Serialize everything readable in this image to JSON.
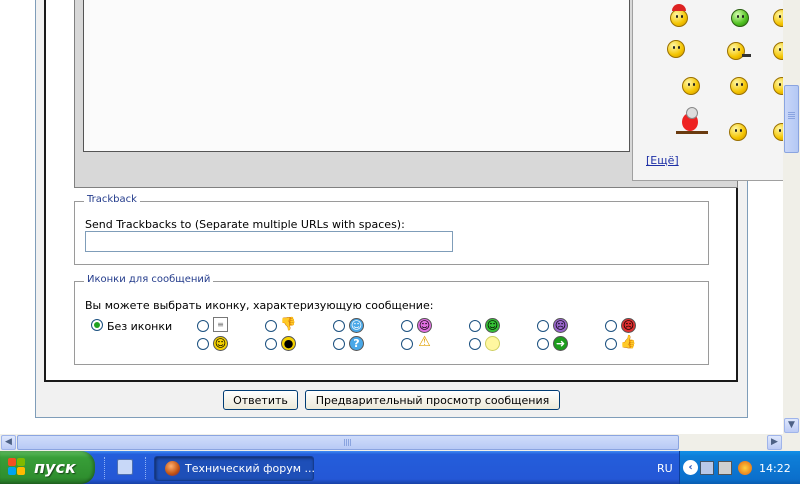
{
  "smilies": {
    "more_link": "[Ещё]",
    "icons": [
      "santa-smiley-icon",
      "green-smiley-icon",
      "smiley-icon",
      "waving-smiley-icon",
      "smoking-smiley-icon",
      "nurse-smiley-icon",
      "smiley-icon",
      "smiley-icon",
      "parrot-icon",
      "angry-smiley-icon",
      "smiley-icon"
    ]
  },
  "trackback": {
    "legend": "Trackback",
    "label": "Send Trackbacks to (Separate multiple URLs with spaces):",
    "value": ""
  },
  "post_icons": {
    "legend": "Иконки для сообщений",
    "label": "Вы можете выбрать иконку, характеризующую сообщение:",
    "no_icon_label": "Без иконки",
    "selected": "none",
    "icons": [
      "document-icon",
      "thumbs-down-icon",
      "wink-icon",
      "pink-smiley-icon",
      "grin-icon",
      "purple-frown-icon",
      "angry-icon",
      "smile-icon",
      "cool-icon",
      "question-icon",
      "warning-icon",
      "lightbulb-icon",
      "arrow-icon",
      "thumbs-up-icon"
    ]
  },
  "buttons": {
    "reply": "Ответить",
    "preview": "Предварительный просмотр сообщения"
  },
  "taskbar": {
    "start_label": "пуск",
    "task_label": "Технический форум ...",
    "language": "RU",
    "clock": "14:22"
  },
  "colors": {
    "taskbar_blue": "#245edb",
    "start_green": "#389e38",
    "link_blue": "#1d2fa6",
    "legend_blue": "#243c8c"
  }
}
